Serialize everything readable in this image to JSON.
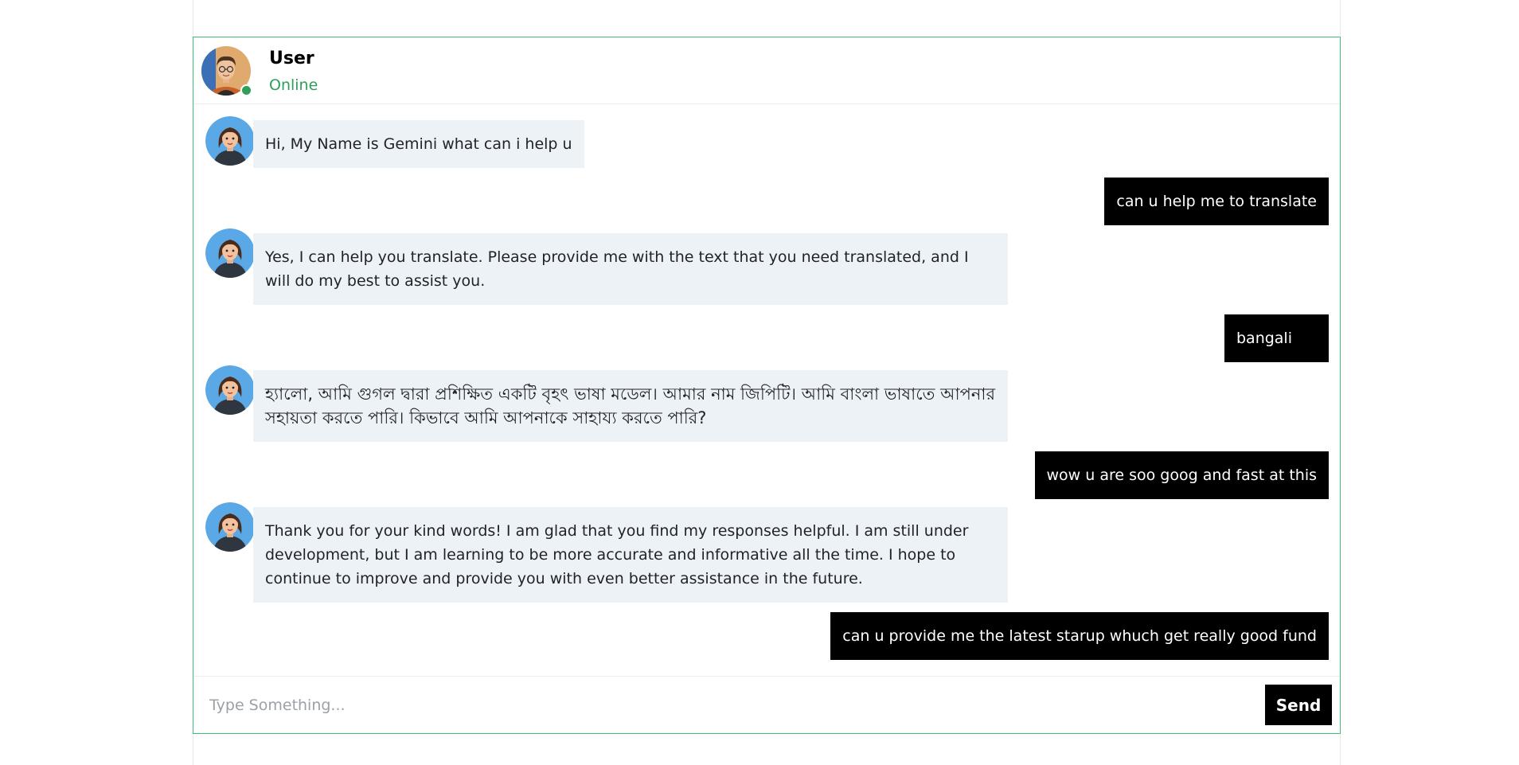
{
  "header": {
    "name": "User",
    "status": "Online",
    "avatar_icon": "user-avatar-icon"
  },
  "messages": [
    {
      "sender": "bot",
      "text": "Hi, My Name is Gemini what can i help u"
    },
    {
      "sender": "user",
      "text": "can u help me to translate"
    },
    {
      "sender": "bot",
      "text": "Yes, I can help you translate. Please provide me with the text that you need translated, and I will do my best to assist you."
    },
    {
      "sender": "user",
      "text": "bangali"
    },
    {
      "sender": "bot",
      "text": "হ্যালো, আমি গুগল দ্বারা প্রশিক্ষিত একটি বৃহৎ ভাষা মডেল। আমার নাম জিপিটি। আমি বাংলা ভাষাতে আপনার সহায়তা করতে পারি। কিভাবে আমি আপনাকে সাহায্য করতে পারি?"
    },
    {
      "sender": "user",
      "text": "wow u are soo goog and fast at this"
    },
    {
      "sender": "bot",
      "text": "Thank you for your kind words! I am glad that you find my responses helpful. I am still under development, but I am learning to be more accurate and informative all the time. I hope to continue to improve and provide you with even better assistance in the future."
    },
    {
      "sender": "user",
      "text": "can u provide me the latest starup whuch get really good fund"
    }
  ],
  "composer": {
    "placeholder": "Type Something...",
    "value": "",
    "send_label": "Send"
  },
  "colors": {
    "accent_border": "#3fbf78",
    "online_status": "#2f9e5b",
    "bot_bubble": "#edf2f7",
    "user_bubble": "#000000"
  }
}
